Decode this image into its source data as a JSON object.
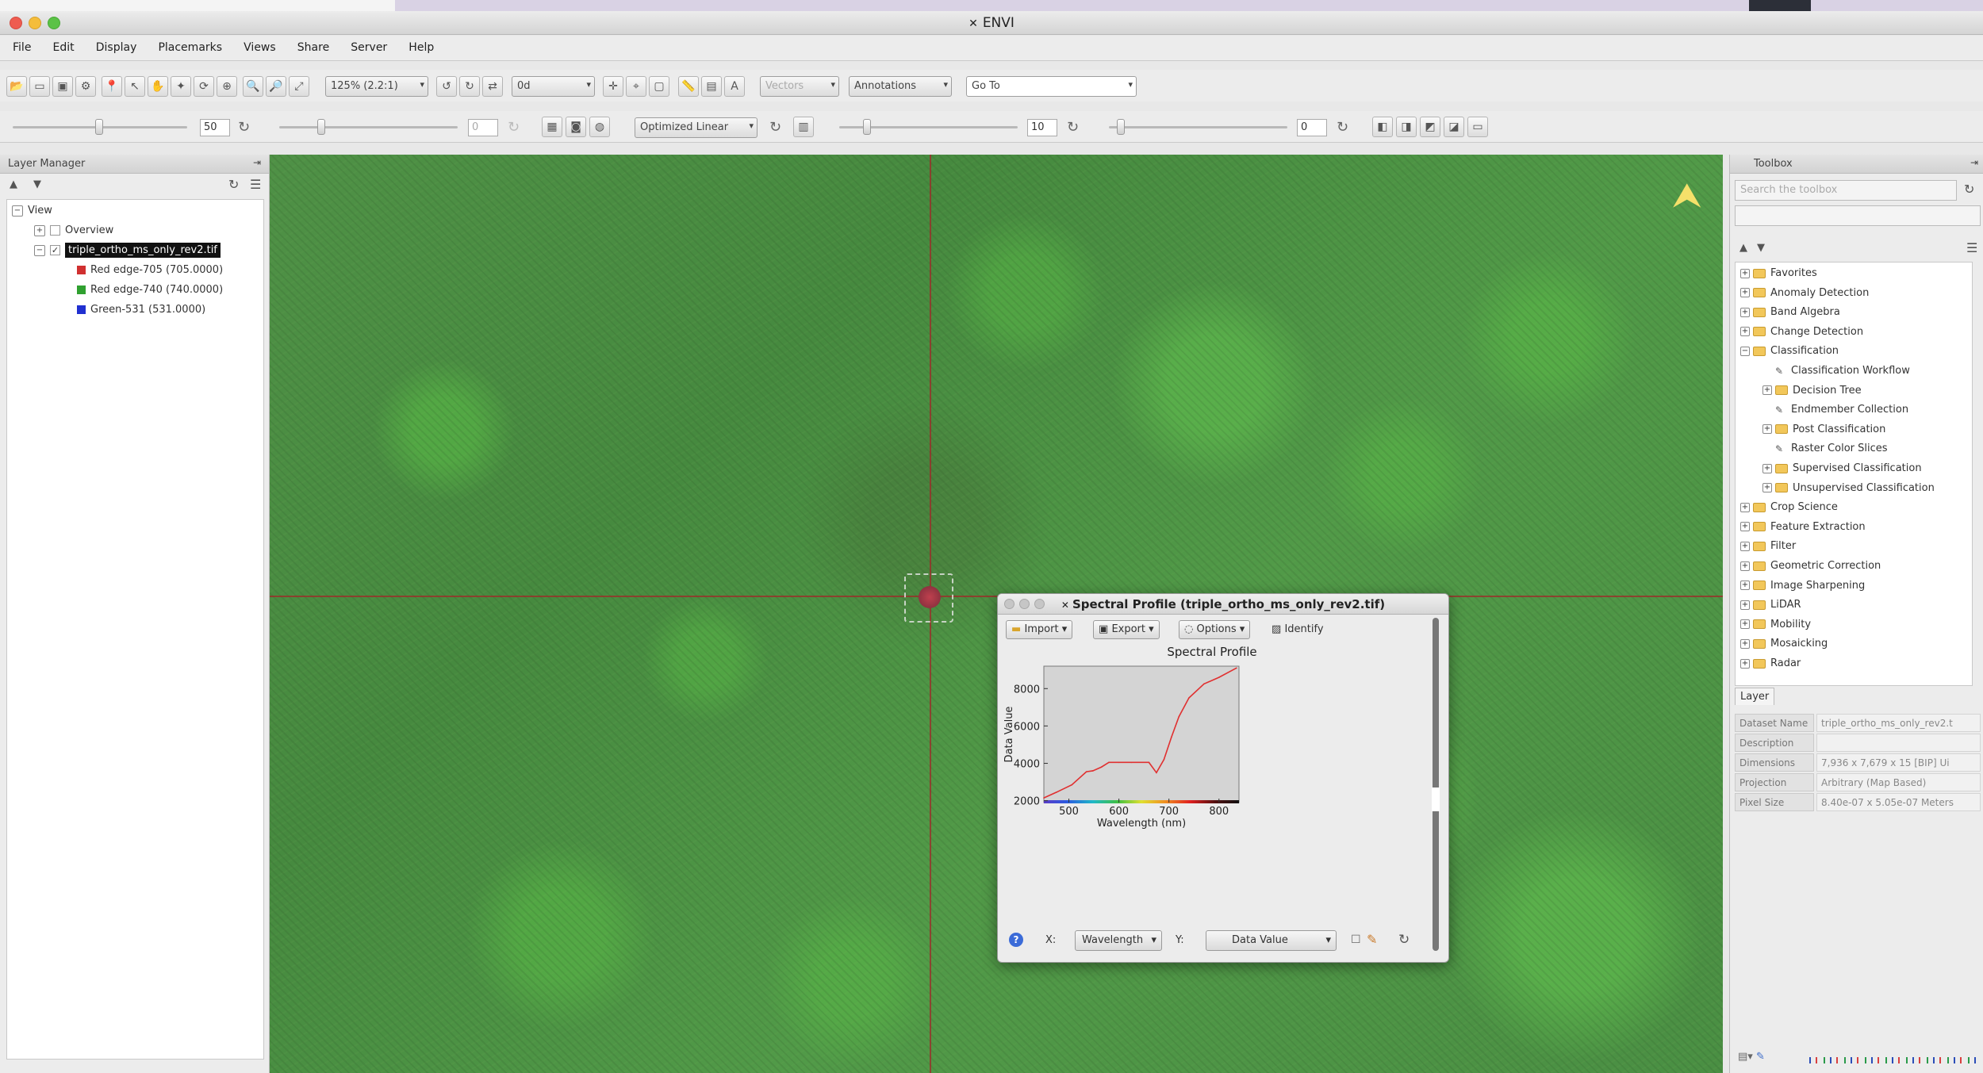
{
  "window": {
    "title": "ENVI"
  },
  "menu": [
    "File",
    "Edit",
    "Display",
    "Placemarks",
    "Views",
    "Share",
    "Server",
    "Help"
  ],
  "toolbar": {
    "zoom_combo": "125% (2.2:1)",
    "rotation_combo": "0d",
    "vectors_label": "Vectors",
    "annotations_label": "Annotations",
    "goto_placeholder": "Go To"
  },
  "toolbar2": {
    "brightness_value": "50",
    "transparency_value": "0",
    "stretch_combo": "Optimized Linear",
    "sharpen_value": "10",
    "contrast_value": "0"
  },
  "layer_manager": {
    "header": "Layer Manager",
    "items": [
      {
        "label": "View",
        "level": 0
      },
      {
        "label": "Overview",
        "level": 1
      },
      {
        "label": "triple_ortho_ms_only_rev2.tif",
        "level": 1,
        "selected": true
      },
      {
        "label": "Red edge-705 (705.0000)",
        "level": 2,
        "color": "#d03030"
      },
      {
        "label": "Red edge-740 (740.0000)",
        "level": 2,
        "color": "#30a030"
      },
      {
        "label": "Green-531 (531.0000)",
        "level": 2,
        "color": "#2030d0"
      }
    ]
  },
  "spectral_profile": {
    "title": "Spectral Profile (triple_ortho_ms_only_rev2.tif)",
    "buttons": {
      "import": "Import",
      "export": "Export",
      "options": "Options",
      "identify": "Identify"
    },
    "x_axis_label": "X:",
    "x_axis_value": "Wavelength",
    "y_axis_label": "Y:",
    "y_axis_value": "Data Value"
  },
  "chart_data": {
    "type": "line",
    "title": "Spectral Profile",
    "xlabel": "Wavelength (nm)",
    "ylabel": "Data Value",
    "xlim": [
      450,
      840
    ],
    "ylim": [
      1900,
      9200
    ],
    "x_ticks": [
      500,
      600,
      700,
      800
    ],
    "y_ticks": [
      2000,
      4000,
      6000,
      8000
    ],
    "series": [
      {
        "color": "#e03030",
        "x": [
          450,
          475,
          506,
          535,
          548,
          565,
          580,
          600,
          625,
          660,
          675,
          690,
          705,
          720,
          740,
          770,
          800,
          835
        ],
        "y": [
          2150,
          2450,
          2850,
          3550,
          3600,
          3800,
          4050,
          4050,
          4050,
          4050,
          3500,
          4200,
          5400,
          6500,
          7500,
          8250,
          8600,
          9100
        ]
      }
    ]
  },
  "toolbox": {
    "header": "Toolbox",
    "search_placeholder": "Search the toolbox",
    "items": [
      {
        "label": "Favorites",
        "level": 0,
        "kind": "folder",
        "exp": "+"
      },
      {
        "label": "Anomaly Detection",
        "level": 0,
        "kind": "folder",
        "exp": "+"
      },
      {
        "label": "Band Algebra",
        "level": 0,
        "kind": "folder",
        "exp": "+"
      },
      {
        "label": "Change Detection",
        "level": 0,
        "kind": "folder",
        "exp": "+"
      },
      {
        "label": "Classification",
        "level": 0,
        "kind": "folder",
        "exp": "-"
      },
      {
        "label": "Classification Workflow",
        "level": 1,
        "kind": "tool",
        "exp": ""
      },
      {
        "label": "Decision Tree",
        "level": 1,
        "kind": "folder",
        "exp": "+"
      },
      {
        "label": "Endmember Collection",
        "level": 1,
        "kind": "tool",
        "exp": ""
      },
      {
        "label": "Post Classification",
        "level": 1,
        "kind": "folder",
        "exp": "+"
      },
      {
        "label": "Raster Color Slices",
        "level": 1,
        "kind": "tool",
        "exp": ""
      },
      {
        "label": "Supervised Classification",
        "level": 1,
        "kind": "folder",
        "exp": "+"
      },
      {
        "label": "Unsupervised Classification",
        "level": 1,
        "kind": "folder",
        "exp": "+"
      },
      {
        "label": "Crop Science",
        "level": 0,
        "kind": "folder",
        "exp": "+"
      },
      {
        "label": "Feature Extraction",
        "level": 0,
        "kind": "folder",
        "exp": "+"
      },
      {
        "label": "Filter",
        "level": 0,
        "kind": "folder",
        "exp": "+"
      },
      {
        "label": "Geometric Correction",
        "level": 0,
        "kind": "folder",
        "exp": "+"
      },
      {
        "label": "Image Sharpening",
        "level": 0,
        "kind": "folder",
        "exp": "+"
      },
      {
        "label": "LiDAR",
        "level": 0,
        "kind": "folder",
        "exp": "+"
      },
      {
        "label": "Mobility",
        "level": 0,
        "kind": "folder",
        "exp": "+"
      },
      {
        "label": "Mosaicking",
        "level": 0,
        "kind": "folder",
        "exp": "+"
      },
      {
        "label": "Radar",
        "level": 0,
        "kind": "folder",
        "exp": "+"
      }
    ]
  },
  "layer_properties": {
    "tab": "Layer",
    "rows": [
      {
        "key": "Dataset Name",
        "value": "triple_ortho_ms_only_rev2.t"
      },
      {
        "key": "Description",
        "value": ""
      },
      {
        "key": "Dimensions",
        "value": "7,936 x 7,679 x 15 [BIP] Ui"
      },
      {
        "key": "Projection",
        "value": "Arbitrary (Map Based)"
      },
      {
        "key": "Pixel Size",
        "value": "8.40e-07 x 5.05e-07 Meters"
      }
    ]
  }
}
